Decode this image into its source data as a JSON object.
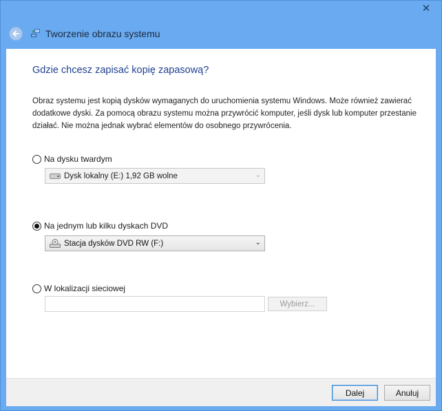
{
  "window": {
    "title": "Tworzenie obrazu systemu",
    "close_glyph": "✕"
  },
  "main": {
    "heading": "Gdzie chcesz zapisać kopię zapasową?",
    "description": "Obraz systemu jest kopią dysków wymaganych do uruchomienia systemu Windows. Może również zawierać dodatkowe dyski. Za pomocą obrazu systemu można przywrócić komputer, jeśli dysk lub komputer przestanie działać. Nie można jednak wybrać elementów do osobnego przywrócenia.",
    "options": {
      "hard_disk": {
        "label": "Na dysku twardym",
        "selected": false,
        "combo_value": "Dysk lokalny (E:)  1,92 GB wolne",
        "combo_icon": "hard-drive-icon"
      },
      "dvd": {
        "label": "Na jednym lub kilku dyskach DVD",
        "selected": true,
        "combo_value": "Stacja dysków DVD RW (F:)",
        "combo_icon": "dvd-drive-icon"
      },
      "network": {
        "label": "W lokalizacji sieciowej",
        "selected": false,
        "path_value": "",
        "browse_label": "Wybierz..."
      }
    }
  },
  "footer": {
    "next_label": "Dalej",
    "cancel_label": "Anuluj"
  },
  "colors": {
    "frame": "#6aaaf0",
    "heading": "#1e3f8f",
    "default_button_border": "#3c8ad6"
  }
}
